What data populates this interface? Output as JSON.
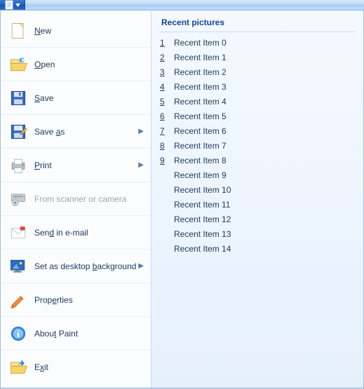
{
  "titlebar": {},
  "menu": {
    "items": [
      {
        "id": "new",
        "label_pre": "",
        "u": "N",
        "label_post": "ew",
        "has_arrow": false,
        "disabled": false,
        "icon": "new"
      },
      {
        "id": "open",
        "label_pre": "",
        "u": "O",
        "label_post": "pen",
        "has_arrow": false,
        "disabled": false,
        "icon": "open"
      },
      {
        "id": "save",
        "label_pre": "",
        "u": "S",
        "label_post": "ave",
        "has_arrow": false,
        "disabled": false,
        "icon": "save"
      },
      {
        "id": "saveas",
        "label_pre": "Save ",
        "u": "a",
        "label_post": "s",
        "has_arrow": true,
        "disabled": false,
        "icon": "saveas"
      },
      {
        "id": "print",
        "label_pre": "",
        "u": "P",
        "label_post": "rint",
        "has_arrow": true,
        "disabled": false,
        "icon": "print"
      },
      {
        "id": "scanner",
        "label_pre": "From scanner or camera",
        "u": "",
        "label_post": "",
        "has_arrow": false,
        "disabled": true,
        "icon": "scanner"
      },
      {
        "id": "email",
        "label_pre": "Sen",
        "u": "d",
        "label_post": " in e-mail",
        "has_arrow": false,
        "disabled": false,
        "icon": "email"
      },
      {
        "id": "wallpaper",
        "label_pre": "Set as desktop ",
        "u": "b",
        "label_post": "ackground",
        "has_arrow": true,
        "disabled": false,
        "icon": "wallpaper"
      },
      {
        "id": "properties",
        "label_pre": "Prop",
        "u": "e",
        "label_post": "rties",
        "has_arrow": false,
        "disabled": false,
        "icon": "properties"
      },
      {
        "id": "about",
        "label_pre": "Abou",
        "u": "t",
        "label_post": " Paint",
        "has_arrow": false,
        "disabled": false,
        "icon": "about"
      },
      {
        "id": "exit",
        "label_pre": "E",
        "u": "x",
        "label_post": "it",
        "has_arrow": false,
        "disabled": false,
        "icon": "exit"
      }
    ]
  },
  "recent": {
    "header": "Recent pictures",
    "items": [
      {
        "num": "1",
        "label": "Recent Item 0"
      },
      {
        "num": "2",
        "label": "Recent Item 1"
      },
      {
        "num": "3",
        "label": "Recent Item 2"
      },
      {
        "num": "4",
        "label": "Recent Item 3"
      },
      {
        "num": "5",
        "label": "Recent Item 4"
      },
      {
        "num": "6",
        "label": "Recent Item 5"
      },
      {
        "num": "7",
        "label": "Recent Item 6"
      },
      {
        "num": "8",
        "label": "Recent Item 7"
      },
      {
        "num": "9",
        "label": "Recent Item 8"
      },
      {
        "num": "",
        "label": "Recent Item 9"
      },
      {
        "num": "",
        "label": "Recent Item 10"
      },
      {
        "num": "",
        "label": "Recent Item 11"
      },
      {
        "num": "",
        "label": "Recent Item 12"
      },
      {
        "num": "",
        "label": "Recent Item 13"
      },
      {
        "num": "",
        "label": "Recent Item 14"
      }
    ]
  }
}
